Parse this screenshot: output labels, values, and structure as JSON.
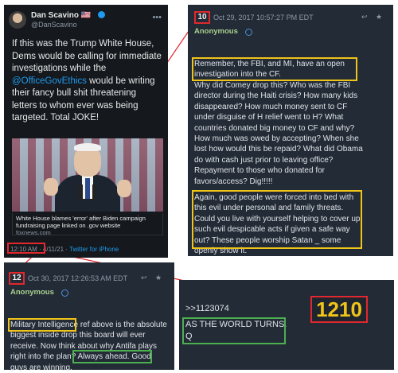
{
  "tweet": {
    "name": "Dan Scavino",
    "flags": "🇺🇸",
    "handle": "@DanScavino",
    "more": "•••",
    "text_part1": "If this was the Trump White House, Dems would be calling for immediate investigations while the ",
    "mention": "@OfficeGovEthics",
    "text_part2": " would be writing their fancy bull shit threatening letters to whom ever was being targeted. Total JOKE!",
    "card_title": "White House blames 'error' after Biden campaign fundraising page linked on .gov website",
    "card_source": "foxnews.com",
    "time": "12:10 AM",
    "date": "4/11/21",
    "sep": " · ",
    "via": "Twitter for iPhone"
  },
  "post10": {
    "number": "10",
    "date": "Oct 29, 2017 10:57:27 PM EDT",
    "author": "Anonymous",
    "icons": "↩ ★",
    "text_highlight": "Remember, the FBI, and MI, have an open investigation into the CF.",
    "text_body": "Why did Comey drop this? Who was the FBI director during the Haiti crisis? How many kids disappeared? How much money sent to CF under disguise of H relief went to H? What countries donated big money to CF and why? How much was owed by accepting? When she lost how would this be repaid? What did Obama do with cash just prior to leaving office? Repayment to those who donated for favors/access? Dig!!!!!",
    "text_highlight2": "Again, good people were forced into bed with this evil under personal and family threats. Could you live with yourself helping to cover up such evil despicable acts if given a safe way out? These people worship Satan _ some openly show it."
  },
  "post12": {
    "number": "12",
    "date": "Oct 30, 2017 12:26:53 AM EDT",
    "author": "Anonymous",
    "icons": "↩ ★",
    "text_highlight": "Military Intelligence",
    "text_body": " ref above is the absolute biggest inside drop this board will ever receive. Now think about why Antifa plays right into the plan? Always ahead. ",
    "text_green": "Good guys are winning."
  },
  "postx": {
    "reply": ">>1123074",
    "line1": "AS THE WORLD TURNS.",
    "line2": "Q",
    "number": "1210"
  },
  "colors": {
    "highlight_yellow": "#f0c419",
    "highlight_red": "#e0282e",
    "highlight_green": "#4caf50"
  }
}
